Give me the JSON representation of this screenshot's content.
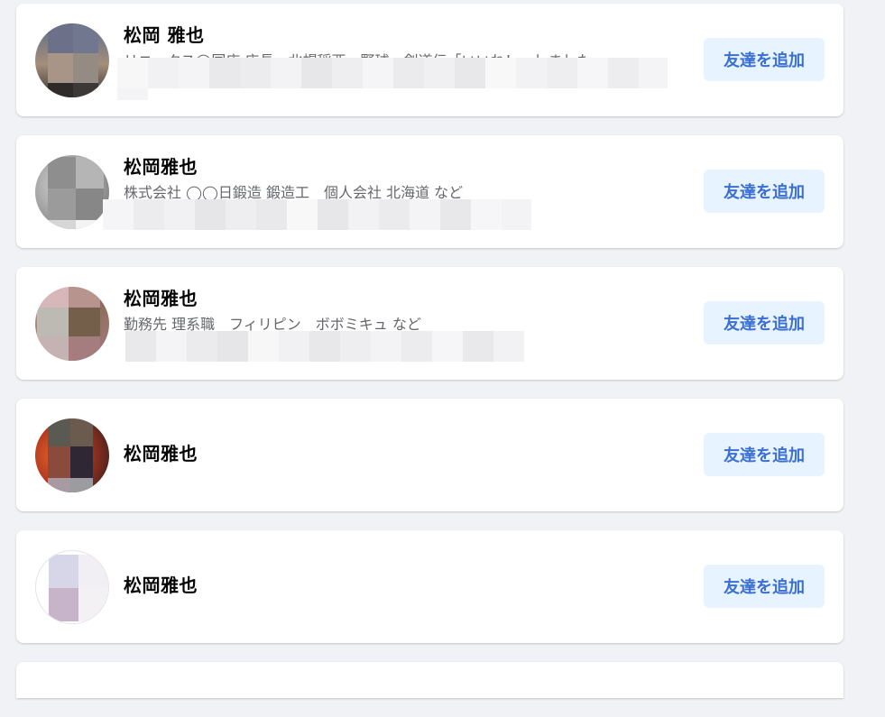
{
  "people": [
    {
      "name": "松岡 雅也",
      "subtitle": "リニークス◯国店 店長　北幌稲西　野球　剣道伝「いいね！」しました",
      "button_label": "友達を追加"
    },
    {
      "name": "松岡雅也",
      "subtitle": "株式会社 ◯◯日鍛造 鍛造工　個人会社 北海道 など",
      "button_label": "友達を追加"
    },
    {
      "name": "松岡雅也",
      "subtitle": "勤務先 理系職　フィリピン　ボボミキュ など",
      "button_label": "友達を追加"
    },
    {
      "name": "松岡雅也",
      "button_label": "友達を追加"
    },
    {
      "name": "松岡雅也",
      "button_label": "友達を追加"
    }
  ],
  "colors": {
    "page_bg": "#f0f2f5",
    "card_bg": "#ffffff",
    "button_bg": "#e7f3ff",
    "button_text": "#3b6fd3",
    "name_text": "#050505",
    "subtitle_text": "#65676b"
  }
}
